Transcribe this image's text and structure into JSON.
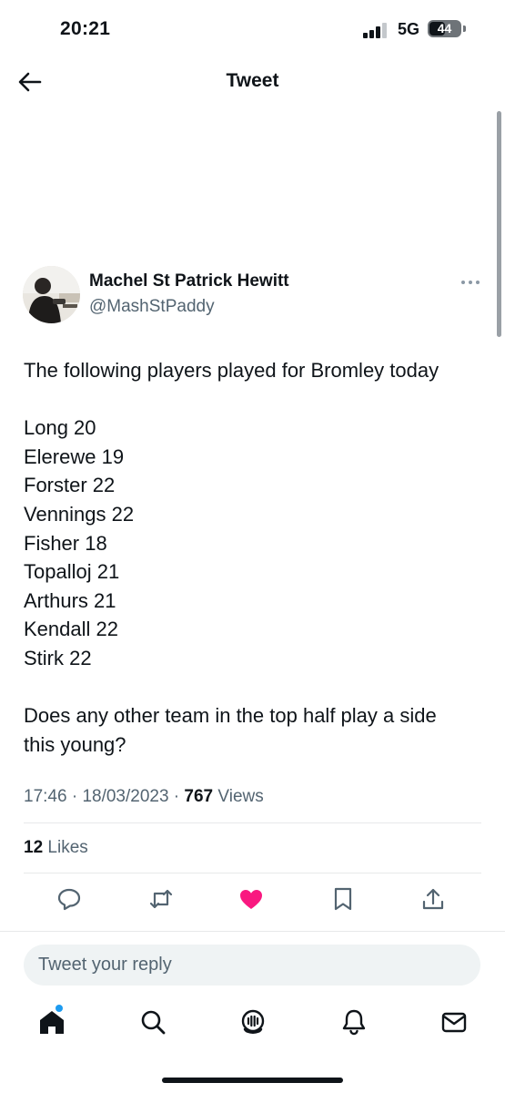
{
  "status_bar": {
    "time": "20:21",
    "network": "5G",
    "battery": "44"
  },
  "header": {
    "title": "Tweet",
    "back_icon": "arrow-left-icon"
  },
  "tweet": {
    "author_name": "Machel St Patrick Hewitt",
    "author_handle": "@MashStPaddy",
    "intro": "The following players played for Bromley today",
    "players": [
      "Long 20",
      "Elerewe 19",
      "Forster 22",
      "Vennings 22",
      "Fisher 18",
      "Topalloj 21",
      "Arthurs 21",
      "Kendall 22",
      "Stirk 22"
    ],
    "question_line1": "Does any other team in the top half play a side",
    "question_line2": "this young?",
    "time": "17:46",
    "date": "18/03/2023",
    "views_count": "767",
    "views_label": "Views",
    "likes_count": "12",
    "likes_label": "Likes"
  },
  "actions": {
    "icons": [
      "reply-icon",
      "retweet-icon",
      "like-icon",
      "bookmark-icon",
      "share-icon"
    ],
    "like_color": "#f91880"
  },
  "reply": {
    "placeholder": "Tweet your reply"
  },
  "bottom_nav": {
    "icons": [
      "home-icon",
      "search-icon",
      "spaces-icon",
      "notifications-icon",
      "messages-icon"
    ],
    "accent": "#1d9bf0"
  }
}
